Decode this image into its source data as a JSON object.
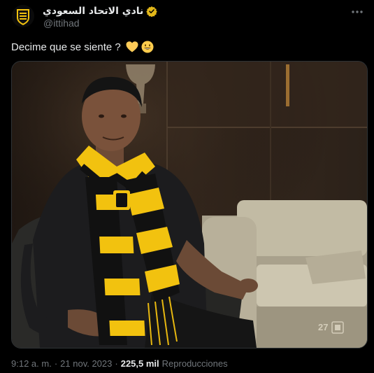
{
  "author": {
    "display_name": "نادي الاتحاد السعودي",
    "handle": "@ittihad",
    "verified": true,
    "avatar_icon": "ittihad-crest-icon"
  },
  "tweet": {
    "text": "Decime que se siente ?",
    "emojis": [
      "yellow-heart-icon",
      "smiling-face-icon"
    ]
  },
  "media": {
    "type": "photo",
    "watermark_icon": "ittihad-watermark-icon"
  },
  "meta": {
    "time": "9:12 a. m.",
    "separator": "·",
    "date": "21 nov. 2023",
    "views_count": "225,5 mil",
    "views_label": "Reproducciones"
  },
  "colors": {
    "background": "#000000",
    "text": "#e7e9ea",
    "secondary": "#71767b",
    "verified_badge": "#e2b719",
    "accent_yellow": "#f2c20f"
  }
}
